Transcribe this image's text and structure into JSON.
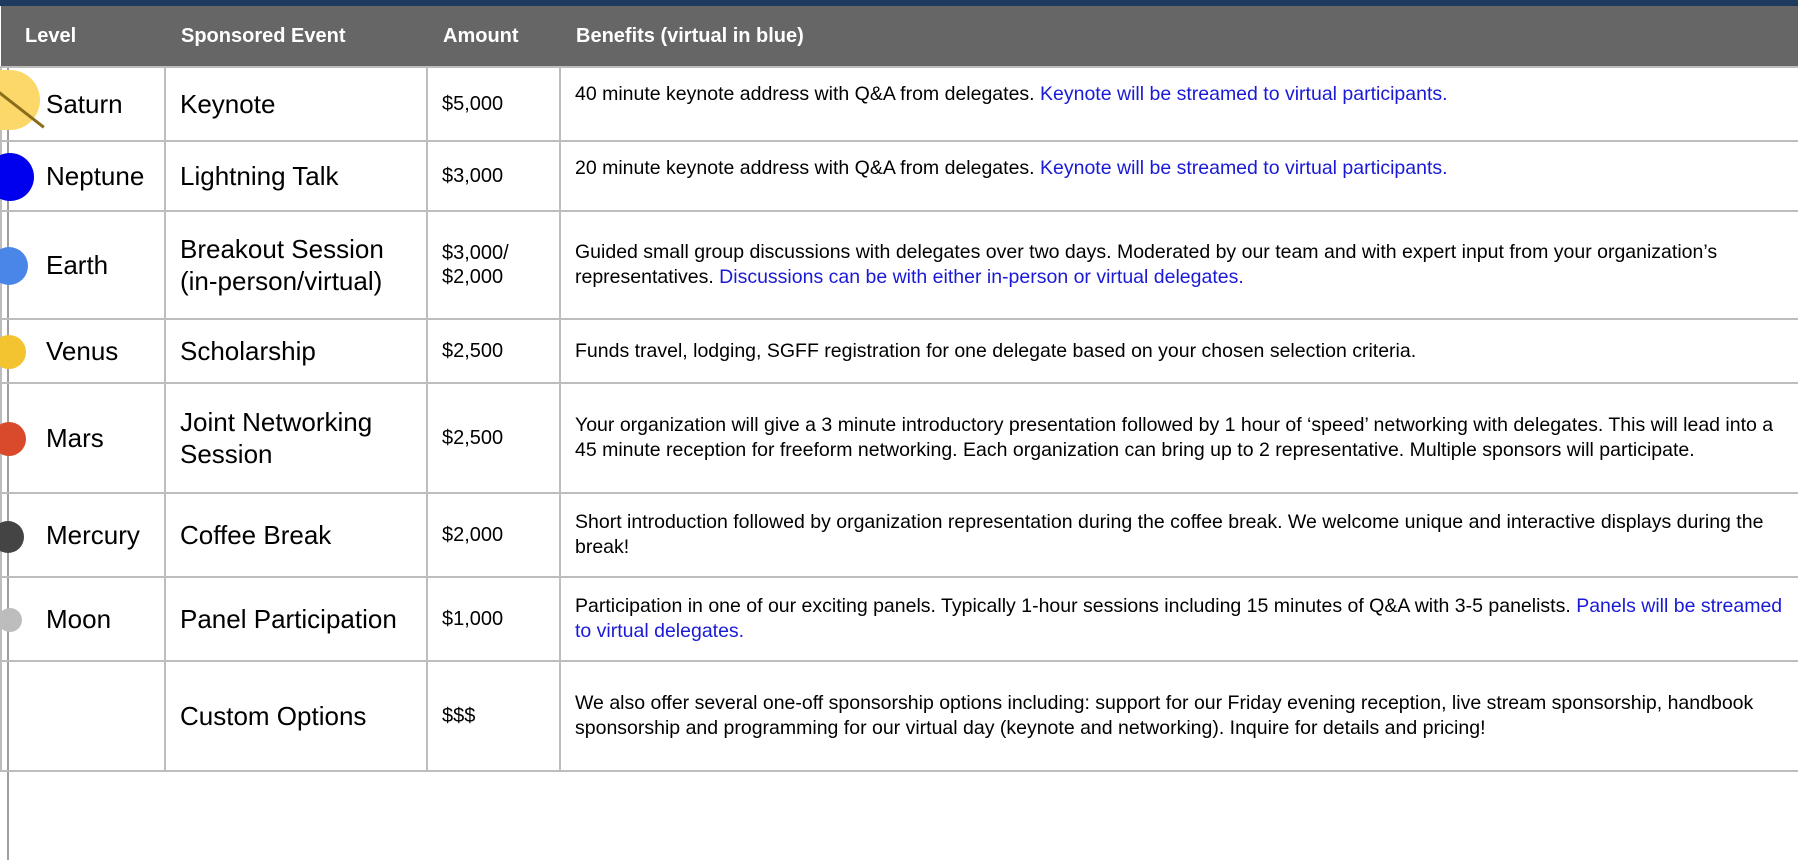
{
  "table": {
    "headers": [
      "Level",
      "Sponsored Event",
      "Amount",
      "Benefits (virtual in blue)"
    ],
    "rows": [
      {
        "level": "Saturn",
        "event": "Keynote",
        "amount": "$5,000",
        "benefit": "40 minute keynote address with Q&A from delegates.",
        "benefit_virtual": "Keynote will be streamed to virtual participants.",
        "planet_color": "#fcd86b"
      },
      {
        "level": "Neptune",
        "event": "Lightning Talk",
        "amount": "$3,000",
        "benefit": "20 minute keynote address with Q&A from delegates.",
        "benefit_virtual": "Keynote will be streamed to virtual participants.",
        "planet_color": "#0000ee"
      },
      {
        "level": "Earth",
        "event": "Breakout Session (in-person/virtual)",
        "amount": "$3,000/ $2,000",
        "benefit": "Guided small group discussions with delegates over two days. Moderated by our team and with expert input from your organization’s representatives.",
        "benefit_virtual": "Discussions can be with either in-person or virtual delegates.",
        "planet_color": "#4a86e8"
      },
      {
        "level": "Venus",
        "event": "Scholarship",
        "amount": "$2,500",
        "benefit": "Funds travel, lodging, SGFF registration for one delegate based on your chosen selection criteria.",
        "benefit_virtual": "",
        "planet_color": "#f4c430"
      },
      {
        "level": "Mars",
        "event": "Joint Networking Session",
        "amount": "$2,500",
        "benefit": "Your organization will give a 3 minute introductory presentation followed by 1 hour of ‘speed’ networking with delegates. This will lead into a 45 minute reception for freeform networking. Each organization can bring up to 2 representative. Multiple sponsors will participate.",
        "benefit_virtual": "",
        "planet_color": "#d84a2b"
      },
      {
        "level": "Mercury",
        "event": "Coffee Break",
        "amount": "$2,000",
        "benefit": "Short introduction followed by organization representation during the coffee break. We welcome unique and interactive displays during the break!",
        "benefit_virtual": "",
        "planet_color": "#444444"
      },
      {
        "level": "Moon",
        "event": "Panel Participation",
        "amount": "$1,000",
        "benefit": "Participation in one of our exciting panels. Typically 1-hour sessions including 15 minutes of Q&A with 3-5 panelists.",
        "benefit_virtual": "Panels will be streamed to virtual delegates.",
        "planet_color": "#bdbdbd"
      },
      {
        "level": "",
        "event": "Custom Options",
        "amount": "$$$",
        "benefit": "We also offer several one-off sponsorship options including: support for our Friday evening reception, live stream sponsorship, handbook sponsorship and programming for our virtual day (keynote and networking). Inquire for details and pricing!",
        "benefit_virtual": "",
        "planet_color": ""
      }
    ]
  },
  "colors": {
    "header_bg": "#666666",
    "virtual_text": "#1a1ad6",
    "border": "#bdbdbd"
  }
}
